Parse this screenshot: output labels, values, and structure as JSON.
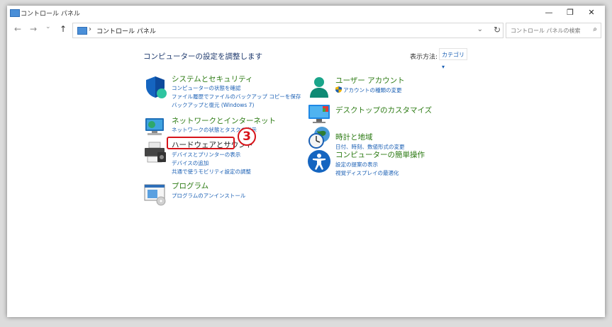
{
  "window": {
    "title": "コントロール パネル",
    "minimize_glyph": "—",
    "maximize_glyph": "❐",
    "close_glyph": "✕"
  },
  "nav": {
    "back_glyph": "←",
    "forward_glyph": "→",
    "history_glyph": "⌄",
    "up_glyph": "↑",
    "breadcrumb_separator": "›",
    "address": "コントロール パネル",
    "dropdown_glyph": "⌄",
    "refresh_glyph": "↻",
    "search_placeholder": "コントロール パネルの検索",
    "search_glyph": "⌕"
  },
  "main": {
    "title": "コンピューターの設定を調整します",
    "view_by_label": "表示方法:",
    "view_by_value": "カテゴリ ▾"
  },
  "categories_left": [
    {
      "icon": "shield-icon",
      "title": "システムとセキュリティ",
      "links": [
        "コンピューターの状態を確認",
        "ファイル履歴でファイルのバックアップ コピーを保存",
        "バックアップと復元 (Windows 7)"
      ]
    },
    {
      "icon": "network-icon",
      "title": "ネットワークとインターネット",
      "links": [
        "ネットワークの状態とタスクの表示"
      ]
    },
    {
      "icon": "printer-icon",
      "title": "ハードウェアとサウンド",
      "links": [
        "デバイスとプリンターの表示",
        "デバイスの追加",
        "共通で使うモビリティ設定の調整"
      ]
    },
    {
      "icon": "programs-icon",
      "title": "プログラム",
      "links": [
        "プログラムのアンインストール"
      ]
    }
  ],
  "categories_right": [
    {
      "icon": "user-accounts-icon",
      "title": "ユーザー アカウント",
      "links": [
        "アカウントの種類の変更"
      ]
    },
    {
      "icon": "desktop-icon",
      "title": "デスクトップのカスタマイズ",
      "links": []
    },
    {
      "icon": "clock-globe-icon",
      "title": "時計と地域",
      "links": [
        "日付、時刻、数値形式の変更"
      ]
    },
    {
      "icon": "accessibility-icon",
      "title": "コンピューターの簡単操作",
      "links": [
        "設定の提案の表示",
        "視覚ディスプレイの最適化"
      ]
    }
  ],
  "annotation": {
    "number": "3"
  },
  "colors": {
    "category_title": "#2b7a12",
    "link": "#1a5fb4",
    "annotation": "#d7141a"
  }
}
